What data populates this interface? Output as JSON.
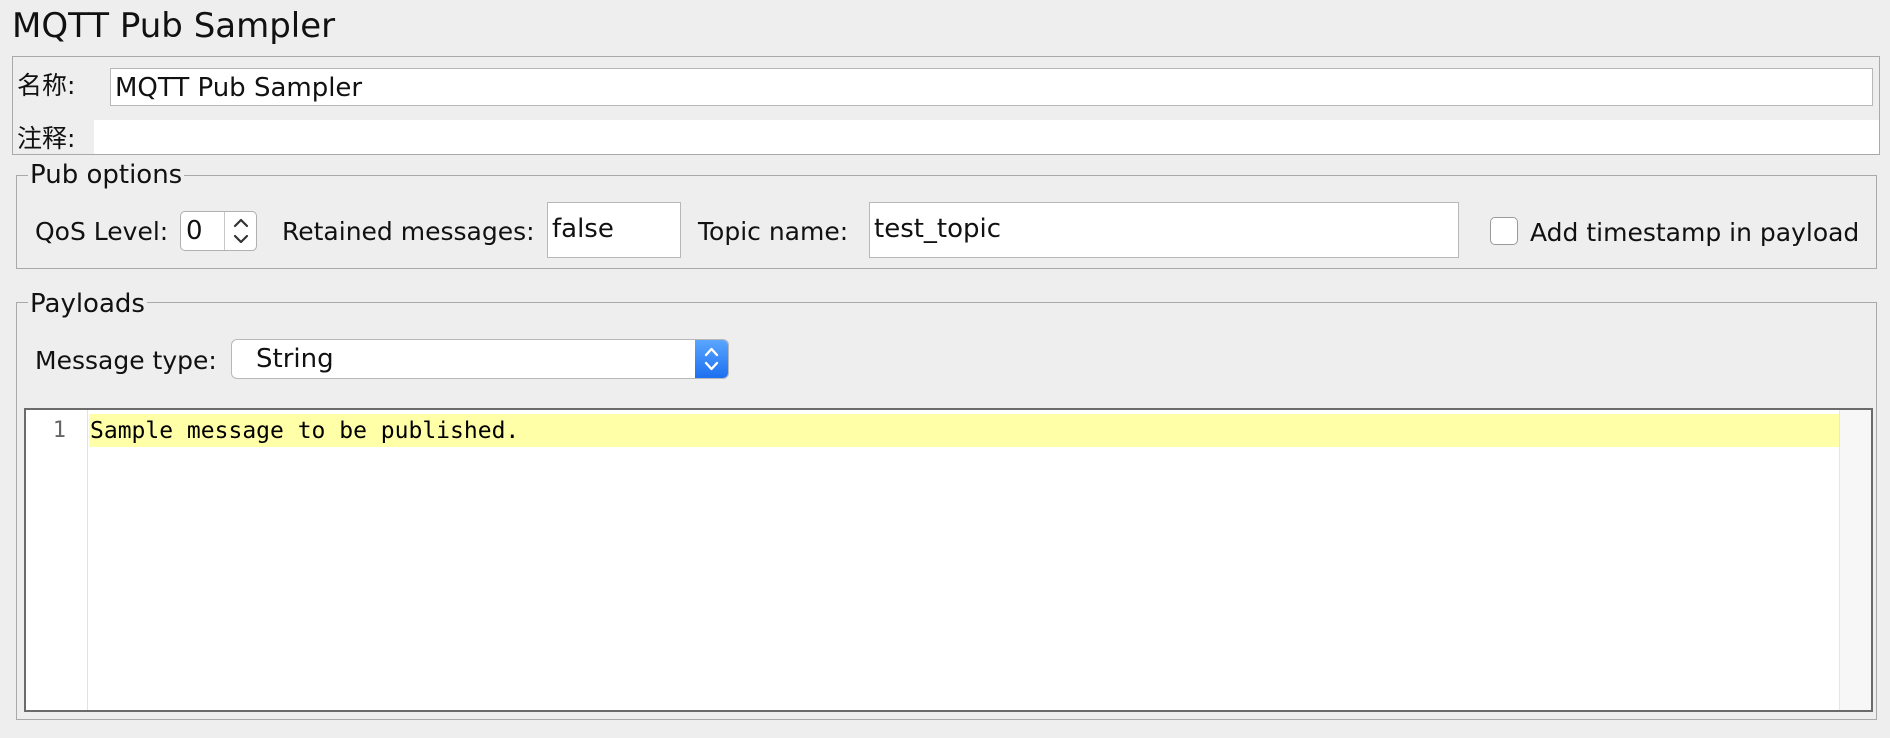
{
  "window": {
    "title": "MQTT Pub Sampler"
  },
  "name_section": {
    "name_label": "名称:",
    "name_value": "MQTT Pub Sampler",
    "comment_label": "注释:",
    "comment_value": ""
  },
  "pub_options": {
    "legend": "Pub options",
    "qos_label": "QoS Level:",
    "qos_value": "0",
    "retained_label": "Retained messages:",
    "retained_value": "false",
    "topic_label": "Topic name:",
    "topic_value": "test_topic",
    "timestamp_label": "Add timestamp in payload",
    "timestamp_checked": false
  },
  "payloads": {
    "legend": "Payloads",
    "message_type_label": "Message type:",
    "message_type_value": "String",
    "editor": {
      "line_number": "1",
      "content": "Sample message to be published."
    }
  },
  "colors": {
    "background": "#eeeeee",
    "highlight_line": "#ffffa8",
    "select_accent": "#1c6ff0"
  },
  "icons": {
    "qos_spinner": "up-down-chevron-icon",
    "message_type_dropdown": "up-down-chevron-icon"
  }
}
